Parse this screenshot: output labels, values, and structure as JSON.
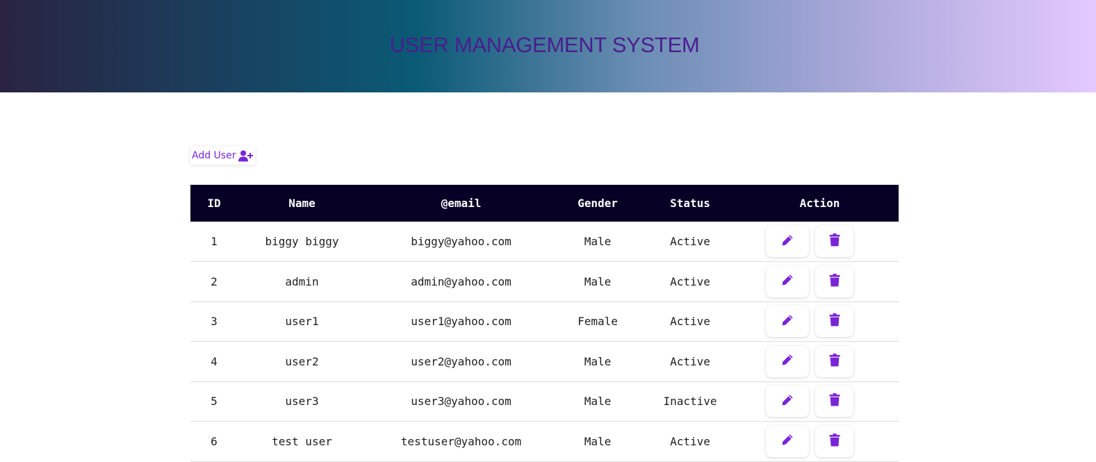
{
  "header": {
    "title": "USER MANAGEMENT SYSTEM"
  },
  "toolbar": {
    "add_user_label": "Add User",
    "add_user_icon": "user-plus-icon"
  },
  "table": {
    "columns": [
      "ID",
      "Name",
      "@email",
      "Gender",
      "Status",
      "Action"
    ],
    "rows": [
      {
        "id": "1",
        "name": "biggy biggy",
        "email": "biggy@yahoo.com",
        "gender": "Male",
        "status": "Active"
      },
      {
        "id": "2",
        "name": "admin",
        "email": "admin@yahoo.com",
        "gender": "Male",
        "status": "Active"
      },
      {
        "id": "3",
        "name": "user1",
        "email": "user1@yahoo.com",
        "gender": "Female",
        "status": "Active"
      },
      {
        "id": "4",
        "name": "user2",
        "email": "user2@yahoo.com",
        "gender": "Male",
        "status": "Active"
      },
      {
        "id": "5",
        "name": "user3",
        "email": "user3@yahoo.com",
        "gender": "Male",
        "status": "Inactive"
      },
      {
        "id": "6",
        "name": "test user",
        "email": "testuser@yahoo.com",
        "gender": "Male",
        "status": "Active"
      }
    ],
    "edit_icon": "pencil-icon",
    "delete_icon": "trash-icon"
  },
  "colors": {
    "accent": "#7a24d6",
    "title": "#4b1d8f",
    "table_header_bg": "#060125"
  }
}
